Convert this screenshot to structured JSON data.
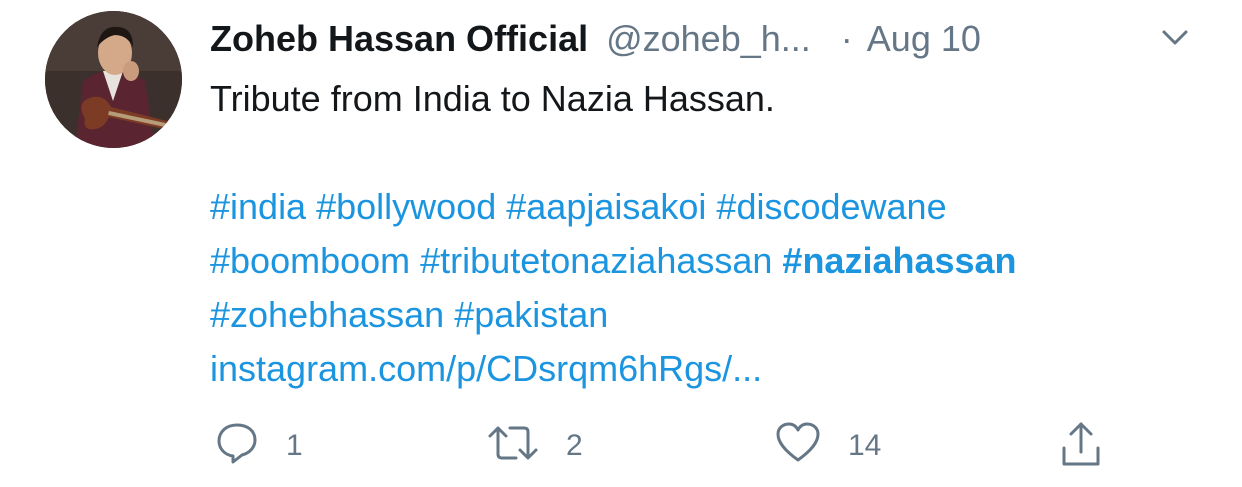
{
  "tweet": {
    "author_name": "Zoheb Hassan Official",
    "handle": "@zoheb_h...",
    "separator": "·",
    "date": "Aug 10",
    "text_line1": "Tribute from India to Nazia Hassan.",
    "hashtags": [
      [
        "#india",
        "#bollywood",
        "#aapjaisakoi",
        "#discodewane"
      ],
      [
        "#boomboom",
        "#tributetonaziahassan",
        "#naziahassan"
      ],
      [
        "#zohebhassan",
        "#pakistan"
      ]
    ],
    "link": "instagram.com/p/CDsrqm6hRgs/..."
  },
  "actions": {
    "reply_count": "1",
    "retweet_count": "2",
    "like_count": "14"
  },
  "colors": {
    "link": "#1b95e0",
    "muted": "#657786",
    "text": "#14171a"
  },
  "icons": {
    "reply": "speech-bubble-icon",
    "retweet": "retweet-arrows-icon",
    "like": "heart-icon",
    "share": "share-upload-icon",
    "menu": "chevron-down-icon"
  }
}
